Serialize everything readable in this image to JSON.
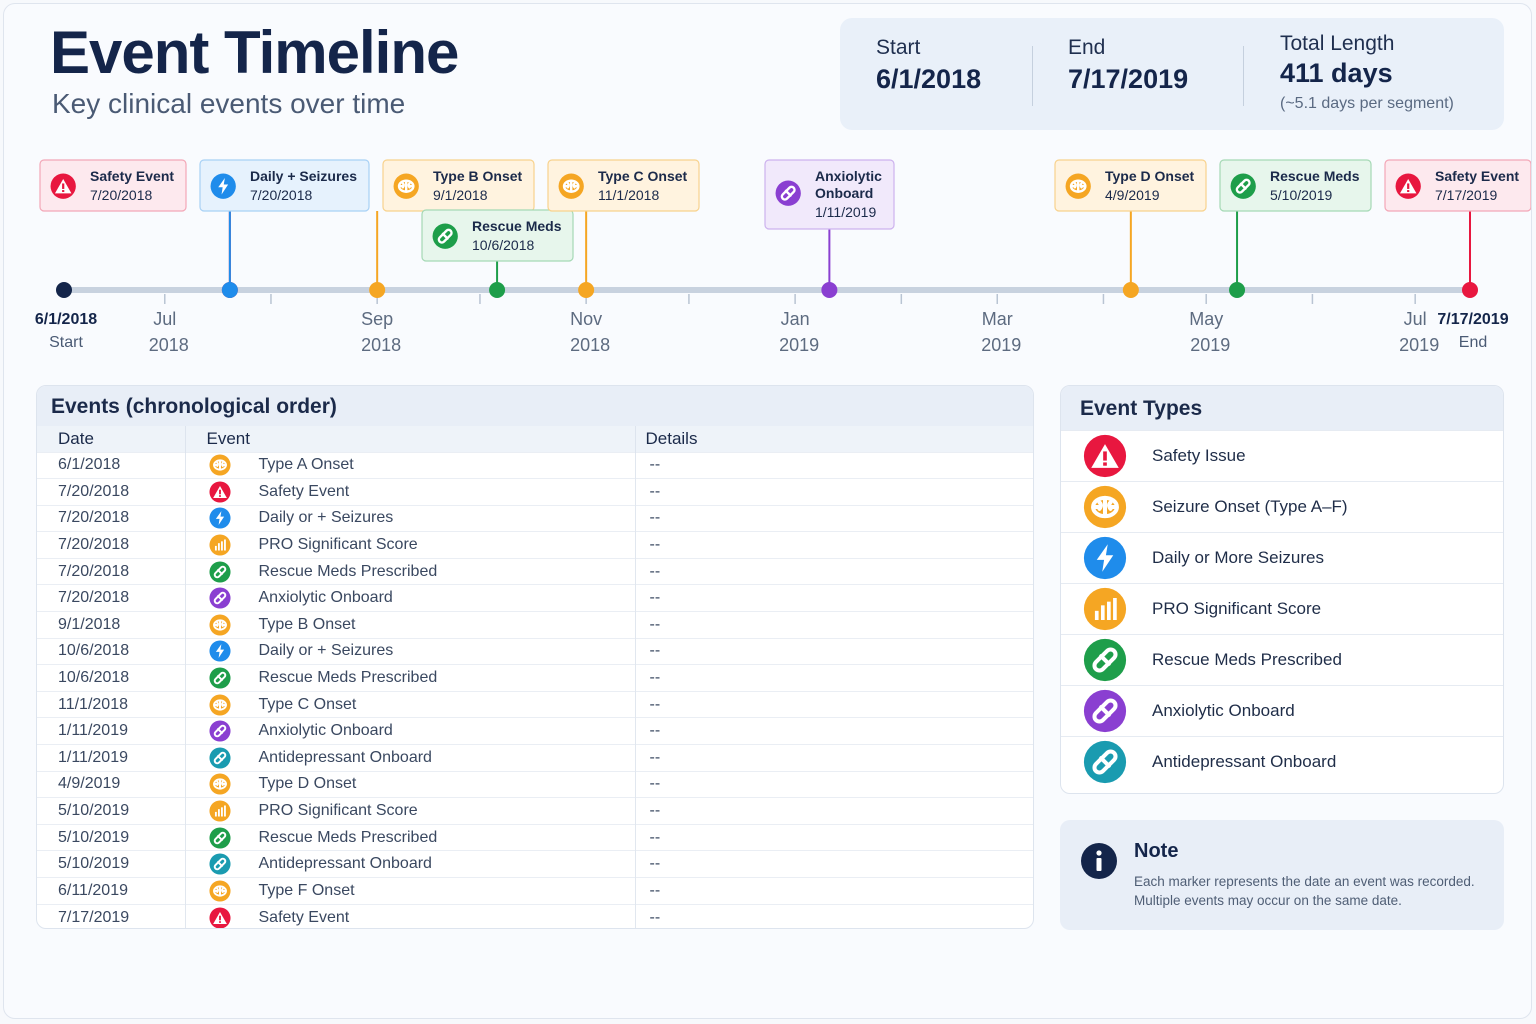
{
  "header": {
    "title": "Event Timeline",
    "subtitle": "Key clinical events over time"
  },
  "summary": {
    "start_label": "Start",
    "start_value": "6/1/2018",
    "end_label": "End",
    "end_value": "7/17/2019",
    "length_label": "Total Length",
    "length_value": "411 days",
    "length_sub": "(~5.1 days per segment)"
  },
  "colors": {
    "safety": "#e8173f",
    "seizure": "#f5a623",
    "daily": "#1f8ceb",
    "pro": "#f5a623",
    "rescue": "#1e9e4a",
    "anxiolytic": "#8a3fd1",
    "antidepressant": "#1a9bb0",
    "axis": "#c8d2df",
    "start_dot": "#14254a"
  },
  "timeline": {
    "start_label": "6/1/2018",
    "start_sub": "Start",
    "end_label": "7/17/2019",
    "end_sub": "End",
    "months": [
      {
        "m": "Jul",
        "y": "2018",
        "date": "2018-07-01"
      },
      {
        "m": "Sep",
        "y": "2018",
        "date": "2018-09-01"
      },
      {
        "m": "Nov",
        "y": "2018",
        "date": "2018-11-01"
      },
      {
        "m": "Jan",
        "y": "2019",
        "date": "2019-01-01"
      },
      {
        "m": "Mar",
        "y": "2019",
        "date": "2019-03-01"
      },
      {
        "m": "May",
        "y": "2019",
        "date": "2019-05-01"
      },
      {
        "m": "Jul",
        "y": "2019",
        "date": "2019-07-01"
      }
    ],
    "minor_ticks": [
      "2018-08-01",
      "2018-10-01",
      "2018-12-01",
      "2019-02-01",
      "2019-04-01",
      "2019-06-01"
    ],
    "callouts": [
      {
        "type": "safety",
        "lines": [
          "Safety Event"
        ],
        "date_text": "7/20/2018",
        "date": "2018-07-20",
        "row": 0
      },
      {
        "type": "daily",
        "lines": [
          "Daily + Seizures"
        ],
        "date_text": "7/20/2018",
        "date": "2018-07-20",
        "row": 0
      },
      {
        "type": "seizure",
        "lines": [
          "Type B Onset"
        ],
        "date_text": "9/1/2018",
        "date": "2018-09-01",
        "row": 0
      },
      {
        "type": "rescue",
        "lines": [
          "Rescue Meds"
        ],
        "date_text": "10/6/2018",
        "date": "2018-10-06",
        "row": 1
      },
      {
        "type": "seizure",
        "lines": [
          "Type C Onset"
        ],
        "date_text": "11/1/2018",
        "date": "2018-11-01",
        "row": 0
      },
      {
        "type": "anxiolytic",
        "lines": [
          "Anxiolytic",
          "Onboard"
        ],
        "date_text": "1/11/2019",
        "date": "2019-01-11",
        "row": 0
      },
      {
        "type": "seizure",
        "lines": [
          "Type D Onset"
        ],
        "date_text": "4/9/2019",
        "date": "2019-04-09",
        "row": 0
      },
      {
        "type": "rescue",
        "lines": [
          "Rescue Meds"
        ],
        "date_text": "5/10/2019",
        "date": "2019-05-10",
        "row": 0
      },
      {
        "type": "safety",
        "lines": [
          "Safety Event"
        ],
        "date_text": "7/17/2019",
        "date": "2019-07-17",
        "row": 0
      }
    ]
  },
  "events_table": {
    "title": "Events (chronological order)",
    "headers": [
      "Date",
      "Event",
      "Details"
    ],
    "rows": [
      {
        "date": "6/1/2018",
        "type": "seizure",
        "event": "Type A Onset",
        "details": "--"
      },
      {
        "date": "7/20/2018",
        "type": "safety",
        "event": "Safety Event",
        "details": "--"
      },
      {
        "date": "7/20/2018",
        "type": "daily",
        "event": "Daily or + Seizures",
        "details": "--"
      },
      {
        "date": "7/20/2018",
        "type": "pro",
        "event": "PRO Significant Score",
        "details": "--"
      },
      {
        "date": "7/20/2018",
        "type": "rescue",
        "event": "Rescue Meds Prescribed",
        "details": "--"
      },
      {
        "date": "7/20/2018",
        "type": "anxiolytic",
        "event": "Anxiolytic Onboard",
        "details": "--"
      },
      {
        "date": "9/1/2018",
        "type": "seizure",
        "event": "Type B Onset",
        "details": "--"
      },
      {
        "date": "10/6/2018",
        "type": "daily",
        "event": "Daily or + Seizures",
        "details": "--"
      },
      {
        "date": "10/6/2018",
        "type": "rescue",
        "event": "Rescue Meds Prescribed",
        "details": "--"
      },
      {
        "date": "11/1/2018",
        "type": "seizure",
        "event": "Type C Onset",
        "details": "--"
      },
      {
        "date": "1/11/2019",
        "type": "anxiolytic",
        "event": "Anxiolytic Onboard",
        "details": "--"
      },
      {
        "date": "1/11/2019",
        "type": "antidepressant",
        "event": "Antidepressant Onboard",
        "details": "--"
      },
      {
        "date": "4/9/2019",
        "type": "seizure",
        "event": "Type D Onset",
        "details": "--"
      },
      {
        "date": "5/10/2019",
        "type": "pro",
        "event": "PRO Significant Score",
        "details": "--"
      },
      {
        "date": "5/10/2019",
        "type": "rescue",
        "event": "Rescue Meds Prescribed",
        "details": "--"
      },
      {
        "date": "5/10/2019",
        "type": "antidepressant",
        "event": "Antidepressant Onboard",
        "details": "--"
      },
      {
        "date": "6/11/2019",
        "type": "seizure",
        "event": "Type F Onset",
        "details": "--"
      },
      {
        "date": "7/17/2019",
        "type": "safety",
        "event": "Safety Event",
        "details": "--"
      }
    ]
  },
  "event_types": {
    "title": "Event Types",
    "items": [
      {
        "type": "safety",
        "icon": "warning-triangle-icon",
        "label": "Safety Issue"
      },
      {
        "type": "seizure",
        "icon": "brain-icon",
        "label": "Seizure Onset (Type A–F)"
      },
      {
        "type": "daily",
        "icon": "lightning-bolt-icon",
        "label": "Daily or More Seizures"
      },
      {
        "type": "pro",
        "icon": "bar-chart-icon",
        "label": "PRO Significant Score"
      },
      {
        "type": "rescue",
        "icon": "pill-icon",
        "label": "Rescue Meds Prescribed"
      },
      {
        "type": "anxiolytic",
        "icon": "pill-icon",
        "label": "Anxiolytic Onboard"
      },
      {
        "type": "antidepressant",
        "icon": "pill-icon",
        "label": "Antidepressant Onboard"
      }
    ]
  },
  "note": {
    "title": "Note",
    "text": "Each marker represents the date an event was recorded. Multiple events may occur on the same date."
  }
}
